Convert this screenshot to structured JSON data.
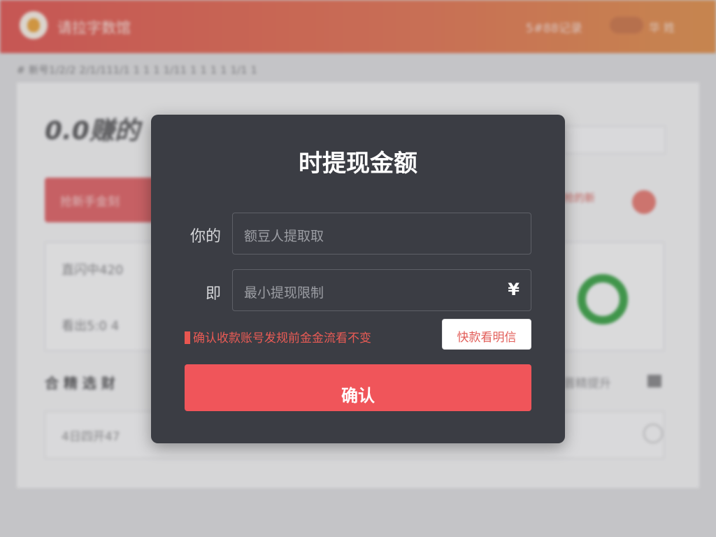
{
  "background": {
    "brand": "请拉字数馆",
    "top_link": "5#88记录",
    "top_user": "华 姓 ",
    "breadcrumb": "# 新号1/2/2 2/1/111/1 1 1 1 1/11 1 1 1 1 1/1 1",
    "balance": "0.0赚的",
    "red_button": "抢新手金刻",
    "right_tools": "抢的新",
    "card_line1": "直闪中420",
    "card_line2": "看出5:0 4",
    "section_title": "合 精 选 财",
    "section_right": "晋精提升",
    "row_text": "4日四开47"
  },
  "modal": {
    "title": "时提现金额",
    "fields": [
      {
        "label": "你的",
        "placeholder": "额豆人提取取"
      },
      {
        "label": "即",
        "placeholder": "最小提现限制",
        "suffix": "¥"
      }
    ],
    "warning": "确认收款账号发规前金金流看不变",
    "link_button": "快款看明信",
    "confirm_button": "确认"
  },
  "colors": {
    "modal_bg": "#3b3d44",
    "accent": "#f0555a",
    "warning": "#ea5b55",
    "topbar_from": "#d94a46",
    "topbar_to": "#d9863f"
  }
}
